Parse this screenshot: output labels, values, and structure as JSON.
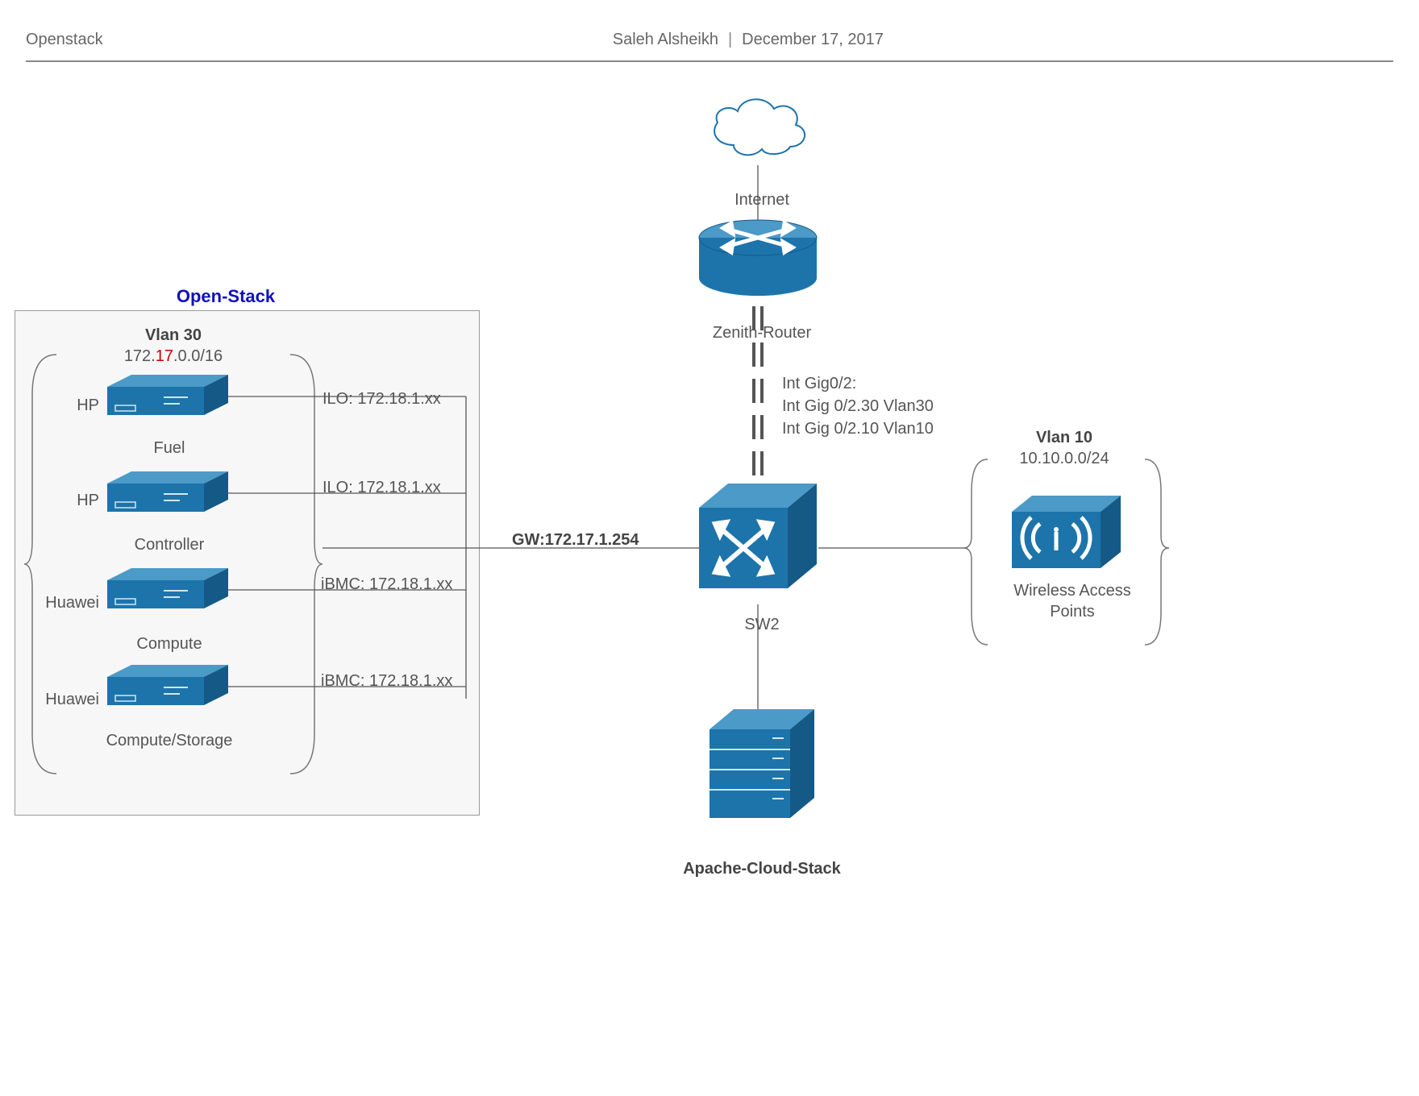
{
  "header": {
    "title": "Openstack",
    "author": "Saleh Alsheikh",
    "date": "December 17, 2017"
  },
  "openstack": {
    "group_title": "Open-Stack",
    "vlan_label": "Vlan 30",
    "subnet_pre": "172.",
    "subnet_mid": "17",
    "subnet_post": ".0.0/16",
    "gateway": "GW:172.17.1.254",
    "servers": [
      {
        "vendor": "HP",
        "name": "Fuel",
        "mgmt": "ILO: 172.18.1.xx"
      },
      {
        "vendor": "HP",
        "name": "Controller",
        "mgmt": "ILO: 172.18.1.xx"
      },
      {
        "vendor": "Huawei",
        "name": "Compute",
        "mgmt": "iBMC: 172.18.1.xx"
      },
      {
        "vendor": "Huawei",
        "name": "Compute/Storage",
        "mgmt": "iBMC: 172.18.1.xx"
      }
    ]
  },
  "net": {
    "internet": "Internet",
    "router": "Zenith-Router",
    "interfaces": [
      "Int Gig0/2:",
      "Int Gig 0/2.30 Vlan30",
      "Int Gig 0/2.10 Vlan10"
    ],
    "switch": "SW2",
    "apache": "Apache-Cloud-Stack"
  },
  "wlan": {
    "vlan_label": "Vlan 10",
    "subnet": "10.10.0.0/24",
    "ap_label": "Wireless Access Points"
  },
  "colors": {
    "device_main": "#1d74ab",
    "device_top": "#4b9ac7",
    "device_dark": "#155a86",
    "highlight": "#cc0000"
  }
}
